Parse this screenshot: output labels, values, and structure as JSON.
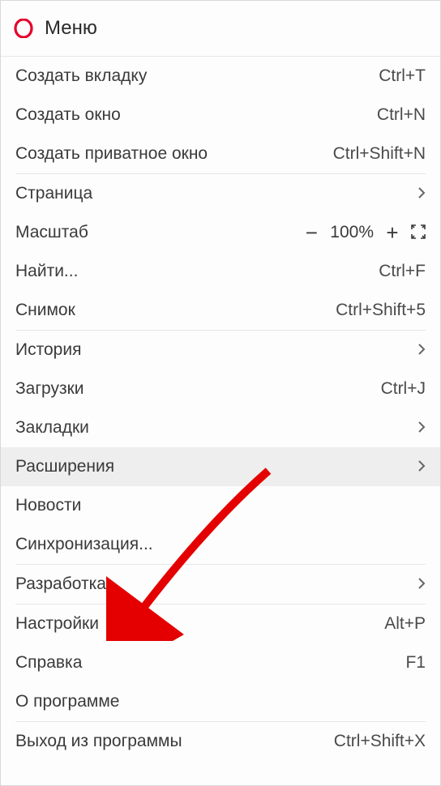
{
  "header": {
    "title": "Меню"
  },
  "items": {
    "new_tab": {
      "label": "Создать вкладку",
      "shortcut": "Ctrl+T"
    },
    "new_window": {
      "label": "Создать окно",
      "shortcut": "Ctrl+N"
    },
    "new_private": {
      "label": "Создать приватное окно",
      "shortcut": "Ctrl+Shift+N"
    },
    "page": {
      "label": "Страница"
    },
    "zoom": {
      "label": "Масштаб",
      "level": "100%"
    },
    "find": {
      "label": "Найти...",
      "shortcut": "Ctrl+F"
    },
    "snapshot": {
      "label": "Снимок",
      "shortcut": "Ctrl+Shift+5"
    },
    "history": {
      "label": "История"
    },
    "downloads": {
      "label": "Загрузки",
      "shortcut": "Ctrl+J"
    },
    "bookmarks": {
      "label": "Закладки"
    },
    "extensions": {
      "label": "Расширения"
    },
    "news": {
      "label": "Новости"
    },
    "sync": {
      "label": "Синхронизация..."
    },
    "developer": {
      "label": "Разработка"
    },
    "settings": {
      "label": "Настройки",
      "shortcut": "Alt+P"
    },
    "help": {
      "label": "Справка",
      "shortcut": "F1"
    },
    "about": {
      "label": "О программе"
    },
    "exit": {
      "label": "Выход из программы",
      "shortcut": "Ctrl+Shift+X"
    }
  },
  "zoom_controls": {
    "minus": "−",
    "plus": "+"
  }
}
